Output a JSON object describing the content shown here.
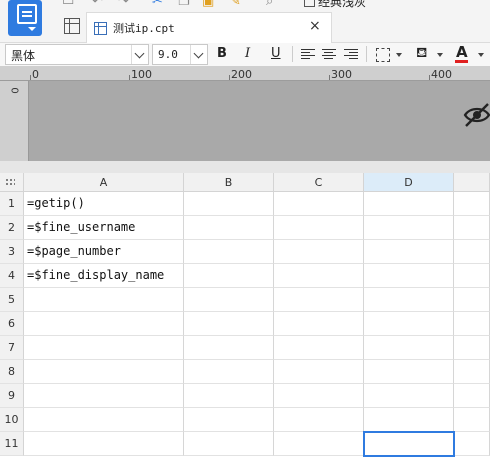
{
  "toolbar": {
    "classic_mode_label": "经典浅灰"
  },
  "tabs": [
    {
      "label": "测试ip.cpt",
      "close": "×"
    }
  ],
  "format_bar": {
    "font_family_value": "黑体",
    "font_size_value": "9.0",
    "bold": "B",
    "italic": "I",
    "underline": "U",
    "font_color_label": "A",
    "font_color": "#e02020"
  },
  "ruler": {
    "ticks": [
      "0",
      "100",
      "200",
      "300",
      "400"
    ],
    "vertical_zero": "0"
  },
  "grid": {
    "columns": [
      "A",
      "B",
      "C",
      "D"
    ],
    "selected_column": "D",
    "rows": [
      "1",
      "2",
      "3",
      "4",
      "5",
      "6",
      "7",
      "8",
      "9",
      "10",
      "11"
    ],
    "cells": {
      "A1": "=getip()",
      "A2": "=$fine_username",
      "A3": "=$page_number",
      "A4": "=$fine_display_name"
    },
    "selected_cell": "D11"
  },
  "colors": {
    "accent": "#2f7be0",
    "selected_header": "#dcecf9"
  }
}
